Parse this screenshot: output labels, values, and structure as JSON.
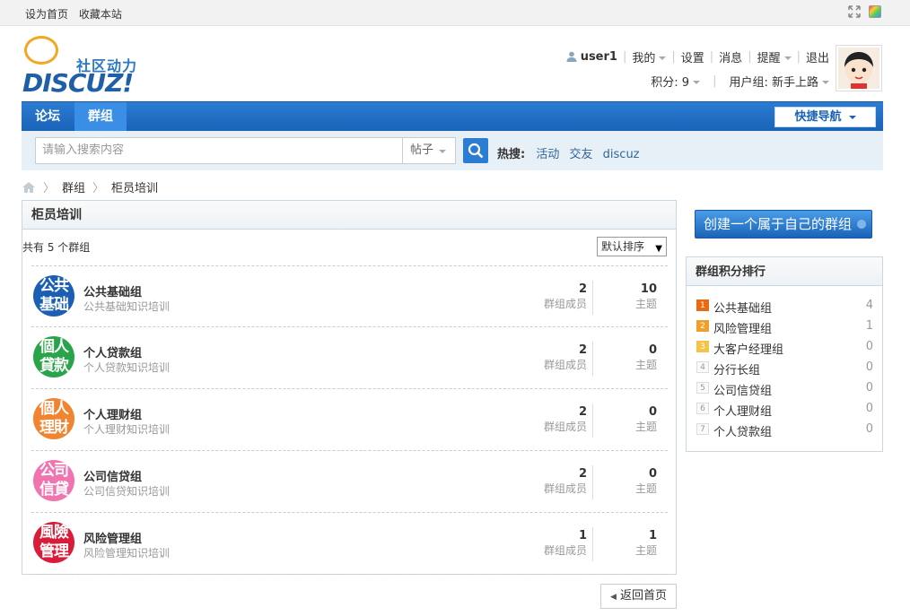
{
  "topbar": {
    "set_home": "设为首页",
    "bookmark": "收藏本站"
  },
  "logo": {
    "cn": "社区动力",
    "en": "DISCUZ!"
  },
  "user": {
    "username": "user1",
    "mine": "我的",
    "settings": "设置",
    "messages": "消息",
    "remind": "提醒",
    "logout": "退出",
    "credits": "积分: 9",
    "usergroup": "用户组: 新手上路"
  },
  "nav": {
    "tabs": [
      {
        "label": "论坛"
      },
      {
        "label": "群组"
      }
    ],
    "quick_nav": "快捷导航"
  },
  "search": {
    "placeholder": "请输入搜索内容",
    "type": "帖子",
    "hot_label": "热搜:",
    "hot": [
      "活动",
      "交友",
      "discuz"
    ]
  },
  "breadcrumb": {
    "items": [
      "群组",
      "柜员培训"
    ]
  },
  "main": {
    "title": "柜员培训",
    "count_text": "共有 5 个群组",
    "sort": "默认排序",
    "member_label": "群组成员",
    "thread_label": "主题",
    "groups": [
      {
        "icon_text": "公共基础",
        "color": "#1a5fb4",
        "name": "公共基础组",
        "desc": "公共基础知识培训",
        "members": "2",
        "threads": "10"
      },
      {
        "icon_text": "個人貸款",
        "color": "#2aa44a",
        "name": "个人贷款组",
        "desc": "个人贷款知识培训",
        "members": "2",
        "threads": "0"
      },
      {
        "icon_text": "個人理財",
        "color": "#f08430",
        "name": "个人理财组",
        "desc": "个人理财知识培训",
        "members": "2",
        "threads": "0"
      },
      {
        "icon_text": "公司信貸",
        "color": "#f074b0",
        "name": "公司信贷组",
        "desc": "公司信贷知识培训",
        "members": "2",
        "threads": "0"
      },
      {
        "icon_text": "風險管理",
        "color": "#d81c3a",
        "name": "风险管理组",
        "desc": "风险管理知识培训",
        "members": "1",
        "threads": "1"
      }
    ],
    "back": "返回首页"
  },
  "sidebar": {
    "create": "创建一个属于自己的群组",
    "rank_title": "群组积分排行",
    "rank": [
      {
        "num": "1",
        "name": "公共基础组",
        "value": "4"
      },
      {
        "num": "2",
        "name": "风险管理组",
        "value": "1"
      },
      {
        "num": "3",
        "name": "大客户经理组",
        "value": "0"
      },
      {
        "num": "4",
        "name": "分行长组",
        "value": "0"
      },
      {
        "num": "5",
        "name": "公司信贷组",
        "value": "0"
      },
      {
        "num": "6",
        "name": "个人理财组",
        "value": "0"
      },
      {
        "num": "7",
        "name": "个人贷款组",
        "value": "0"
      }
    ]
  }
}
